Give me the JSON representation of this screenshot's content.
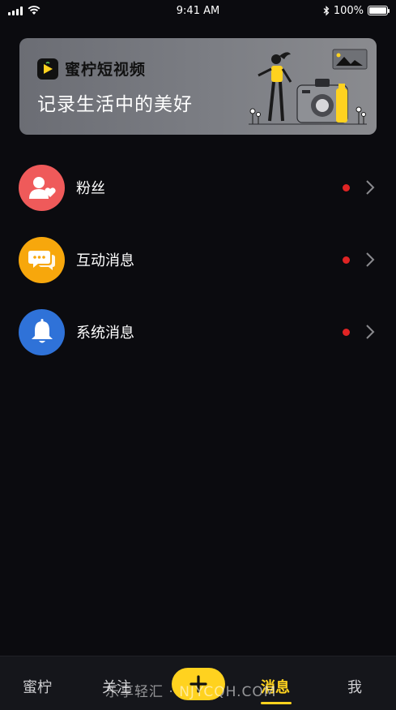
{
  "status_bar": {
    "time": "9:41 AM",
    "battery": "100%"
  },
  "banner": {
    "brand": "蜜柠短视频",
    "slogan": "记录生活中的美好"
  },
  "messages": [
    {
      "label": "粉丝",
      "icon": "fans-icon",
      "color": "#ef5a5a"
    },
    {
      "label": "互动消息",
      "icon": "chat-icon",
      "color": "#f7a70c"
    },
    {
      "label": "系统消息",
      "icon": "bell-icon",
      "color": "#2f72d8"
    }
  ],
  "tabs": [
    {
      "label": "蜜柠"
    },
    {
      "label": "关注"
    },
    {
      "label": "消息",
      "active": true
    },
    {
      "label": "我"
    }
  ],
  "watermark": "乐享轻汇 · NJYCQH.COM",
  "colors": {
    "accent": "#ffd21f",
    "background": "#0b0b0f",
    "dot": "#e02424"
  }
}
